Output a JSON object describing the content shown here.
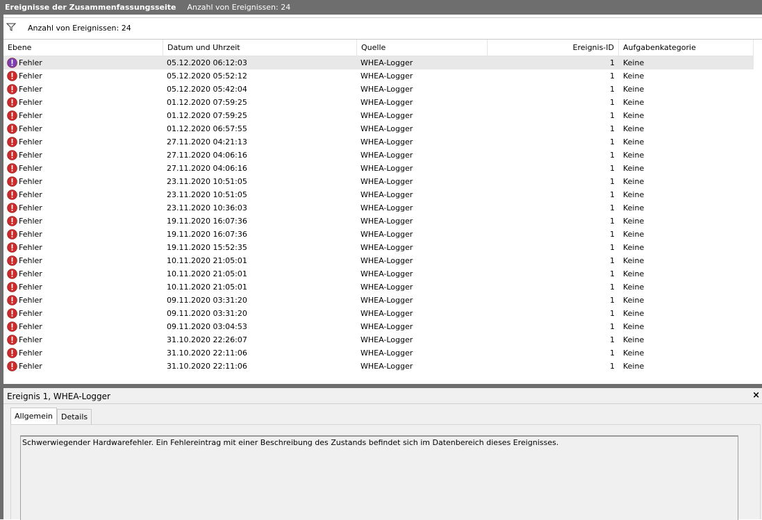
{
  "titlebar": {
    "title": "Ereignisse der Zusammenfassungsseite",
    "count_label": "Anzahl von Ereignissen: 24"
  },
  "filterbar": {
    "count_label": "Anzahl von Ereignissen: 24",
    "icon": "filter-icon"
  },
  "columns": {
    "level": "Ebene",
    "date": "Datum und Uhrzeit",
    "source": "Quelle",
    "event_id": "Ereignis-ID",
    "category": "Aufgabenkategorie"
  },
  "events": [
    {
      "level": "Fehler",
      "date": "05.12.2020 06:12:03",
      "source": "WHEA-Logger",
      "id": "1",
      "category": "Keine"
    },
    {
      "level": "Fehler",
      "date": "05.12.2020 05:52:12",
      "source": "WHEA-Logger",
      "id": "1",
      "category": "Keine"
    },
    {
      "level": "Fehler",
      "date": "05.12.2020 05:42:04",
      "source": "WHEA-Logger",
      "id": "1",
      "category": "Keine"
    },
    {
      "level": "Fehler",
      "date": "01.12.2020 07:59:25",
      "source": "WHEA-Logger",
      "id": "1",
      "category": "Keine"
    },
    {
      "level": "Fehler",
      "date": "01.12.2020 07:59:25",
      "source": "WHEA-Logger",
      "id": "1",
      "category": "Keine"
    },
    {
      "level": "Fehler",
      "date": "01.12.2020 06:57:55",
      "source": "WHEA-Logger",
      "id": "1",
      "category": "Keine"
    },
    {
      "level": "Fehler",
      "date": "27.11.2020 04:21:13",
      "source": "WHEA-Logger",
      "id": "1",
      "category": "Keine"
    },
    {
      "level": "Fehler",
      "date": "27.11.2020 04:06:16",
      "source": "WHEA-Logger",
      "id": "1",
      "category": "Keine"
    },
    {
      "level": "Fehler",
      "date": "27.11.2020 04:06:16",
      "source": "WHEA-Logger",
      "id": "1",
      "category": "Keine"
    },
    {
      "level": "Fehler",
      "date": "23.11.2020 10:51:05",
      "source": "WHEA-Logger",
      "id": "1",
      "category": "Keine"
    },
    {
      "level": "Fehler",
      "date": "23.11.2020 10:51:05",
      "source": "WHEA-Logger",
      "id": "1",
      "category": "Keine"
    },
    {
      "level": "Fehler",
      "date": "23.11.2020 10:36:03",
      "source": "WHEA-Logger",
      "id": "1",
      "category": "Keine"
    },
    {
      "level": "Fehler",
      "date": "19.11.2020 16:07:36",
      "source": "WHEA-Logger",
      "id": "1",
      "category": "Keine"
    },
    {
      "level": "Fehler",
      "date": "19.11.2020 16:07:36",
      "source": "WHEA-Logger",
      "id": "1",
      "category": "Keine"
    },
    {
      "level": "Fehler",
      "date": "19.11.2020 15:52:35",
      "source": "WHEA-Logger",
      "id": "1",
      "category": "Keine"
    },
    {
      "level": "Fehler",
      "date": "10.11.2020 21:05:01",
      "source": "WHEA-Logger",
      "id": "1",
      "category": "Keine"
    },
    {
      "level": "Fehler",
      "date": "10.11.2020 21:05:01",
      "source": "WHEA-Logger",
      "id": "1",
      "category": "Keine"
    },
    {
      "level": "Fehler",
      "date": "10.11.2020 21:05:01",
      "source": "WHEA-Logger",
      "id": "1",
      "category": "Keine"
    },
    {
      "level": "Fehler",
      "date": "09.11.2020 03:31:20",
      "source": "WHEA-Logger",
      "id": "1",
      "category": "Keine"
    },
    {
      "level": "Fehler",
      "date": "09.11.2020 03:31:20",
      "source": "WHEA-Logger",
      "id": "1",
      "category": "Keine"
    },
    {
      "level": "Fehler",
      "date": "09.11.2020 03:04:53",
      "source": "WHEA-Logger",
      "id": "1",
      "category": "Keine"
    },
    {
      "level": "Fehler",
      "date": "31.10.2020 22:26:07",
      "source": "WHEA-Logger",
      "id": "1",
      "category": "Keine"
    },
    {
      "level": "Fehler",
      "date": "31.10.2020 22:11:06",
      "source": "WHEA-Logger",
      "id": "1",
      "category": "Keine"
    },
    {
      "level": "Fehler",
      "date": "31.10.2020 22:11:06",
      "source": "WHEA-Logger",
      "id": "1",
      "category": "Keine"
    }
  ],
  "selected_row": 0,
  "detail": {
    "title": "Ereignis 1, WHEA-Logger",
    "close_symbol": "×",
    "tabs": [
      {
        "label": "Allgemein",
        "active": true
      },
      {
        "label": "Details",
        "active": false
      }
    ],
    "description": "Schwerwiegender Hardwarefehler. Ein Fehlereintrag mit einer Beschreibung des Zustands befindet sich im Datenbereich dieses Ereignisses."
  },
  "colors": {
    "error_icon": "#cc2b2b",
    "chrome": "#6e6e6e",
    "selected_row": "#e8e8e8"
  }
}
